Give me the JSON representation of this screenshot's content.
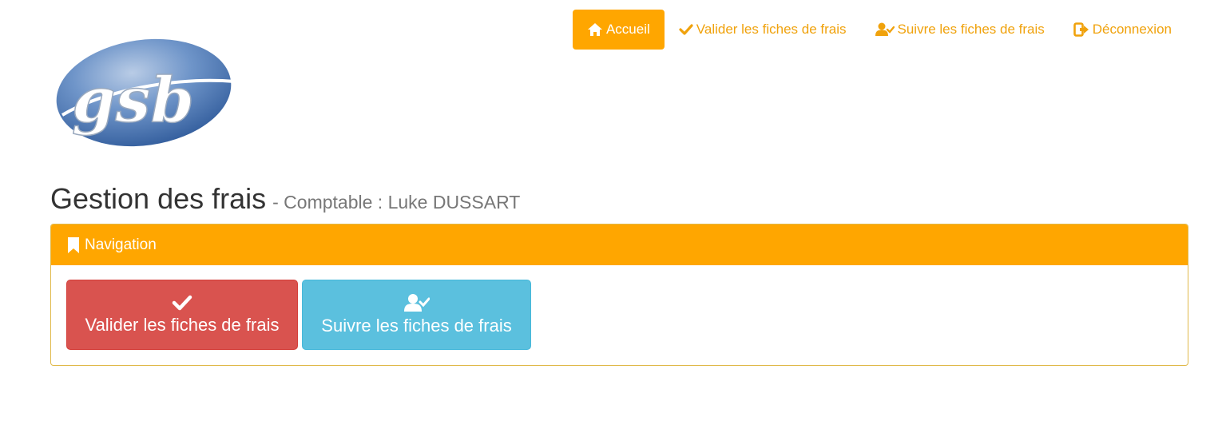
{
  "nav": {
    "items": [
      {
        "label": "Accueil",
        "icon": "home-icon",
        "active": true
      },
      {
        "label": "Valider les fiches de frais",
        "icon": "check-icon",
        "active": false
      },
      {
        "label": "Suivre les fiches de frais",
        "icon": "user-check-icon",
        "active": false
      },
      {
        "label": "Déconnexion",
        "icon": "logout-icon",
        "active": false
      }
    ]
  },
  "logo": {
    "text": "gsb"
  },
  "heading": {
    "title": "Gestion des frais",
    "subtitle": "- Comptable : Luke DUSSART"
  },
  "panel": {
    "title": "Navigation",
    "buttons": [
      {
        "label": "Valider les fiches de frais",
        "icon": "check-icon"
      },
      {
        "label": "Suivre les fiches de frais",
        "icon": "user-check-icon"
      }
    ]
  },
  "colors": {
    "accent": "#ffa600",
    "danger": "#d9534f",
    "info": "#5bc0de"
  }
}
